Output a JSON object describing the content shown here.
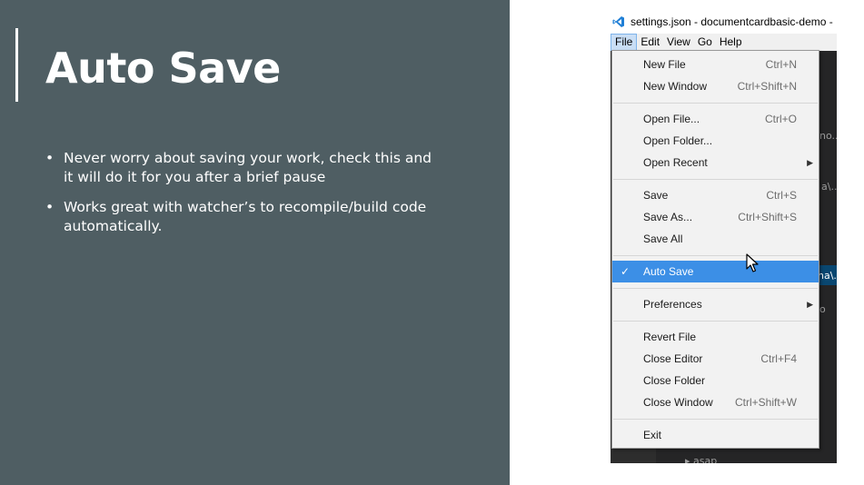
{
  "slide": {
    "title": "Auto Save",
    "bullets": [
      {
        "bullet": "•",
        "text": "Never worry about saving your work, check this and it will do it for you after a brief pause"
      },
      {
        "bullet": "•",
        "text": "Works great with watcher’s to recompile/build code automatically."
      }
    ]
  },
  "window": {
    "title": "settings.json - documentcardbasic-demo -",
    "menu": [
      "File",
      "Edit",
      "View",
      "Go",
      "Help"
    ],
    "active_menu": "File",
    "background_fragments": [
      "no..",
      "a\\..",
      "na\\.",
      "o",
      "asap"
    ]
  },
  "file_menu": {
    "items": [
      {
        "label": "New File",
        "shortcut": "Ctrl+N"
      },
      {
        "label": "New Window",
        "shortcut": "Ctrl+Shift+N"
      },
      {
        "label": "Open File...",
        "shortcut": "Ctrl+O"
      },
      {
        "label": "Open Folder...",
        "shortcut": ""
      },
      {
        "label": "Open Recent",
        "shortcut": ""
      },
      {
        "label": "Save",
        "shortcut": "Ctrl+S"
      },
      {
        "label": "Save As...",
        "shortcut": "Ctrl+Shift+S"
      },
      {
        "label": "Save All",
        "shortcut": ""
      },
      {
        "label": "Auto Save",
        "shortcut": "",
        "checked": true
      },
      {
        "label": "Preferences",
        "shortcut": ""
      },
      {
        "label": "Revert File",
        "shortcut": ""
      },
      {
        "label": "Close Editor",
        "shortcut": "Ctrl+F4"
      },
      {
        "label": "Close Folder",
        "shortcut": ""
      },
      {
        "label": "Close Window",
        "shortcut": "Ctrl+Shift+W"
      },
      {
        "label": "Exit",
        "shortcut": ""
      }
    ],
    "check_glyph": "✓",
    "submenu_glyph": "▶"
  },
  "colors": {
    "slide_bg": "#4f5e63",
    "highlight": "#3c8fe6",
    "vscode_blue": "#1f7fd6"
  }
}
